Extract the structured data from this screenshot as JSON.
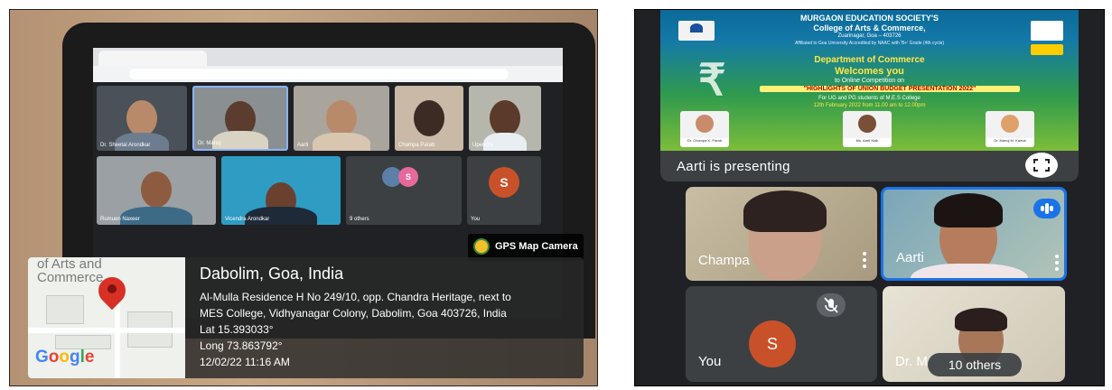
{
  "left_photo": {
    "gps_badge": {
      "label": "GPS Map Camera"
    },
    "map": {
      "street_text_line1": "of Arts and",
      "street_text_line2": "Commerce",
      "logo": [
        "G",
        "o",
        "o",
        "g",
        "l",
        "e"
      ]
    },
    "location": {
      "title": "Dabolim, Goa, India",
      "address_line1": "Al-Mulla Residence H No 249/10, opp. Chandra Heritage, next to",
      "address_line2": "MES College, Vidhyanagar Colony, Dabolim, Goa 403726, India",
      "lat": "Lat 15.393033°",
      "long": "Long 73.863792°",
      "datetime": "12/02/22 11:16 AM"
    },
    "meet_tiles": [
      {
        "name": "Dr. Sheetal Arondkar"
      },
      {
        "name": "Dr. Manoj"
      },
      {
        "name": "Aarti"
      },
      {
        "name": "Champa Parab"
      },
      {
        "name": "Upendra"
      },
      {
        "name": "Rumuen Naxeer"
      },
      {
        "name": "Vicendra Arondkar"
      },
      {
        "name": "9 others"
      },
      {
        "name": "You"
      }
    ]
  },
  "right_screenshot": {
    "poster": {
      "society": "MURGAON EDUCATION SOCIETY'S",
      "college": "College of Arts & Commerce,",
      "address": "Zuarinagar, Goa – 403726",
      "affiliation": "Affiliated to Goa University Accredited by NAAC with 'B+' Grade (4th cycle)",
      "department": "Department of Commerce",
      "welcome": "Welcomes you",
      "online": "to Online Competition on",
      "highlight": "\"HIGHLIGHTS OF UNION BUDGET PRESENTATION 2022\"",
      "for_students": "For UG and PG students of M.E.S College",
      "date": "12th February 2022 from 11.00 am to 12.00pm",
      "speakers": [
        {
          "caption": "Dr. Champa K. Parab"
        },
        {
          "caption": "Ms. Aarti Naik"
        },
        {
          "caption": "Dr. Manoj M. Kamat"
        }
      ]
    },
    "presenting_caption": "Aarti is presenting",
    "participants": [
      {
        "name": "Champa"
      },
      {
        "name": "Aarti"
      },
      {
        "name": "You",
        "avatar_letter": "S"
      },
      {
        "name": "Dr. M",
        "others": "10 others"
      }
    ],
    "colors": {
      "speaking": "#1a73e8",
      "avatar": "#c9512a",
      "meet_bg": "#202124"
    }
  }
}
